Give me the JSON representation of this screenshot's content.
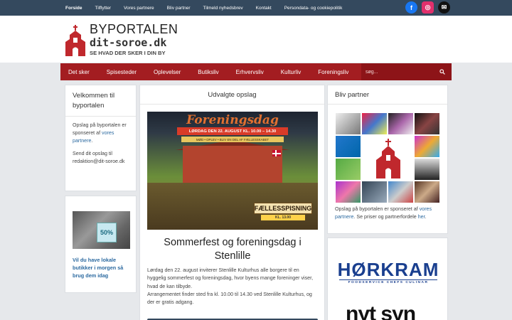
{
  "topnav": {
    "items": [
      {
        "label": "Forside",
        "active": true
      },
      {
        "label": "Tilflytter",
        "active": false
      },
      {
        "label": "Vores partnere",
        "active": false
      },
      {
        "label": "Bliv partner",
        "active": false
      },
      {
        "label": "Tilmeld nyhedsbrev",
        "active": false
      },
      {
        "label": "Kontakt",
        "active": false
      },
      {
        "label": "Persondata- og cookiepolitik",
        "active": false
      }
    ],
    "social": {
      "facebook": "f",
      "instagram": "◎",
      "mail": "✉"
    }
  },
  "header": {
    "title": "BYPORTALEN",
    "domain": "dit-soroe.dk",
    "tagline": "SE HVAD DER SKER I DIN BY"
  },
  "mainnav": {
    "items": [
      "Det sker",
      "Spisesteder",
      "Oplevelser",
      "Butiksliv",
      "Erhvervsliv",
      "Kulturliv",
      "Foreningsliv"
    ],
    "search_placeholder": "søg..."
  },
  "welcome": {
    "title": "Velkommen til byportalen",
    "p1_prefix": "Opslag på byportalen er sponseret af ",
    "p1_link": "vores partnere",
    "p1_suffix": ".",
    "p2": "Send dit opslag til redaktion@dit-soroe.dk"
  },
  "promo": {
    "badge": "50%",
    "link": "Vil du have lokale butikker i morgen så brug dem idag"
  },
  "featured": {
    "heading": "Udvalgte opslag",
    "poster": {
      "banner": "Foreningsdag",
      "ribbon": "LØRDAG DEN 22. AUGUST KL. 10.00 – 14.30",
      "sub": "MØD • OPLEV • BLIV EN DEL AF FÆLLESSKABET",
      "sign": "FÆLLESSPISNING",
      "sign2": "KL. 13.00"
    },
    "post_title": "Sommerfest og foreningsdag i Stenlille",
    "post_body_1": "Lørdag den 22. august inviterer Stenlille Kulturhus alle borgere til en hyggelig sommerfest og foreningsdag, hvor byens mange foreninger viser, hvad de kan tilbyde.",
    "post_body_2": "Arrangementet finder sted fra kl. 10.00 til 14.30 ved Stenlille Kulturhus, og der er gratis adgang."
  },
  "partner": {
    "title": "Bliv partner",
    "text_prefix": "Opslag på byportalen er sponseret af ",
    "text_link1": "vores partnere",
    "text_mid": ". Se priser og partnerfordele ",
    "text_link2": "her",
    "text_suffix": "."
  },
  "sponsor": {
    "name": "HØRKRAM",
    "sub": "FOODSERVICE CHEFS CULINAR",
    "second": "nyt syn"
  },
  "colors": {
    "topbar": "#34495e",
    "mainnav": "#a31d21",
    "link": "#2c6aa0"
  }
}
